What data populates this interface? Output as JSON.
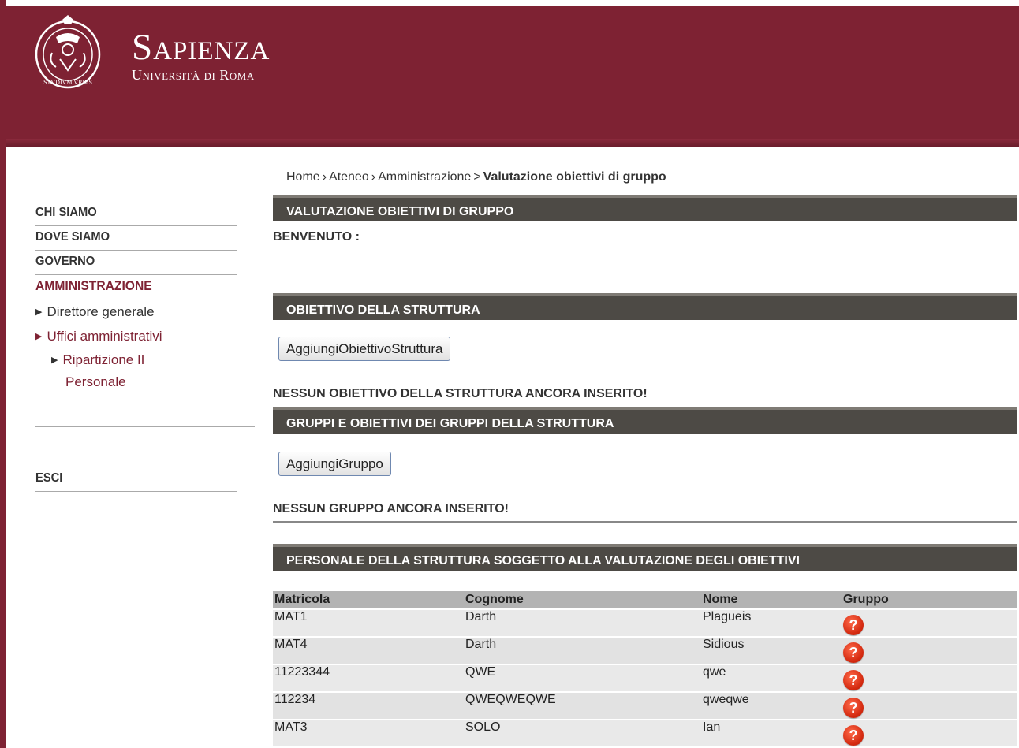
{
  "brand": {
    "title": "Sapienza",
    "subtitle": "Università di Roma",
    "seal_text": "STVDIVM VRBIS"
  },
  "sidebar": {
    "items": [
      {
        "label": "CHI SIAMO"
      },
      {
        "label": "DOVE SIAMO"
      },
      {
        "label": "GOVERNO"
      },
      {
        "label": "AMMINISTRAZIONE"
      }
    ],
    "sub_items": [
      {
        "label": "Direttore generale"
      },
      {
        "label": "Uffici amministrativi"
      }
    ],
    "sub_sub_items": [
      {
        "label_line1": "Ripartizione II",
        "label_line2": "Personale"
      }
    ],
    "logout": "ESCI"
  },
  "breadcrumb": {
    "home": "Home",
    "ateneo": "Ateneo",
    "amministrazione": "Amministrazione",
    "current": "Valutazione obiettivi di gruppo",
    "sep1": "›",
    "sep2": "›",
    "sep3": ">"
  },
  "main": {
    "page_title": "VALUTAZIONE OBIETTIVI DI GRUPPO",
    "welcome": "BENVENUTO :",
    "section_objective": "OBIETTIVO DELLA STRUTTURA",
    "add_objective_button": "AggiungiObiettivoStruttura",
    "no_objective_msg": "NESSUN OBIETTIVO DELLA STRUTTURA ANCORA INSERITO!",
    "section_groups": "GRUPPI E OBIETTIVI DEI GRUPPI DELLA STRUTTURA",
    "add_group_button": "AggiungiGruppo",
    "no_group_msg": "NESSUN GRUPPO ANCORA INSERITO!",
    "section_staff": "PERSONALE DELLA STRUTTURA SOGGETTO ALLA VALUTAZIONE DEGLI OBIETTIVI"
  },
  "table": {
    "headers": [
      "Matricola",
      "Cognome",
      "Nome",
      "Gruppo"
    ],
    "rows": [
      [
        "MAT1",
        "Darth",
        "Plagueis"
      ],
      [
        "MAT4",
        "Darth",
        "Sidious"
      ],
      [
        "11223344",
        "QWE",
        "qwe"
      ],
      [
        "112234",
        "QWEQWEQWE",
        "qweqwe"
      ],
      [
        "MAT3",
        "SOLO",
        "Ian"
      ]
    ],
    "group_icon": "question-icon",
    "group_icon_glyph": "?"
  },
  "colors": {
    "brand": "#7e2233",
    "section_bar": "#4d4a45"
  }
}
